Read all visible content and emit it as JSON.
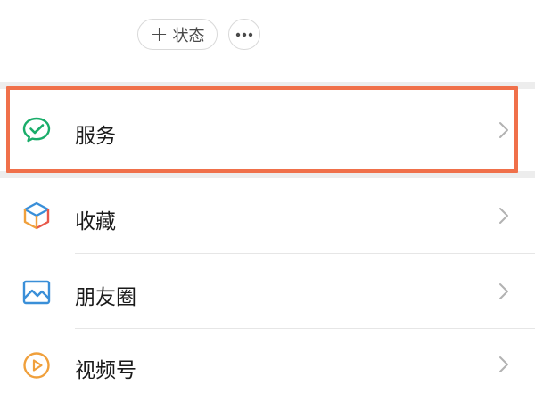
{
  "header": {
    "status_button": {
      "icon": "plus-icon",
      "label": "状态"
    },
    "more_button": {
      "icon": "ellipsis-icon"
    }
  },
  "menu": {
    "items": [
      {
        "id": "services",
        "label": "服务",
        "icon": "services-check-chat-icon",
        "highlighted": true
      },
      {
        "id": "favorites",
        "label": "收藏",
        "icon": "favorites-cube-icon",
        "highlighted": false
      },
      {
        "id": "moments",
        "label": "朋友圈",
        "icon": "moments-picture-icon",
        "highlighted": false
      },
      {
        "id": "channels",
        "label": "视频号",
        "icon": "channels-play-icon",
        "highlighted": false
      }
    ]
  },
  "colors": {
    "highlight_border": "#f0704a",
    "services_green": "#1aad6a",
    "moments_blue": "#3a8fd8",
    "channels_orange": "#f0a03c",
    "chevron": "#b2b2b2"
  }
}
